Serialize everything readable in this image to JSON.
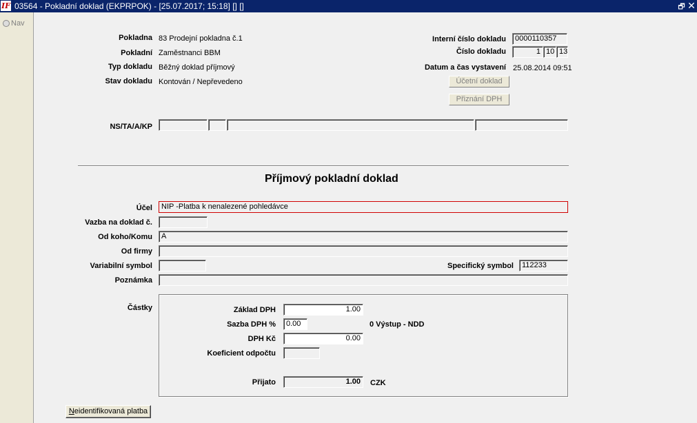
{
  "window": {
    "app_icon_text": "IF",
    "title": "03564 - Pokladní doklad (EKPRPOK) - [25.07.2017; 15:18] [] []",
    "restore_glyph": "🗗",
    "close_glyph": "✕"
  },
  "nav": {
    "label": "Nav"
  },
  "header": {
    "pokladna_label": "Pokladna",
    "pokladna_value": "83 Prodejní pokladna č.1",
    "pokladni_label": "Pokladní",
    "pokladni_value": "Zaměstnanci BBM",
    "typ_label": "Typ dokladu",
    "typ_value": "Běžný doklad příjmový",
    "stav_label": "Stav dokladu",
    "stav_value": "Kontován / Nepřevedeno",
    "interni_label": "Interní číslo dokladu",
    "interni_value": "0000110357",
    "cislo_label": "Číslo dokladu",
    "cislo_part1": "1",
    "cislo_part2": "10",
    "cislo_part3": "13",
    "datum_label": "Datum a čas vystavení",
    "datum_value": "25.08.2014 09:51",
    "ucetni_button": "Účetní doklad",
    "priznani_button": "Přiznání DPH",
    "ns_label": "NS/TA/A/KP",
    "ns_values": [
      "",
      "",
      "",
      ""
    ]
  },
  "form": {
    "heading": "Příjmový pokladní doklad",
    "ucel_label": "Účel",
    "ucel_value": "NIP -Platba k nenalezené pohledávce",
    "vazba_label": "Vazba na doklad č.",
    "vazba_value": "",
    "odkoho_label": "Od koho/Komu",
    "odkoho_value": "A",
    "odfirmy_label": "Od firmy",
    "odfirmy_value": "",
    "vs_label": "Variabilní symbol",
    "vs_value": "",
    "ss_label": "Specifický symbol",
    "ss_value": "112233",
    "poznamka_label": "Poznámka",
    "poznamka_value": ""
  },
  "castky": {
    "section_label": "Částky",
    "zaklad_label": "Základ DPH",
    "zaklad_value": "1.00",
    "sazba_label": "Sazba DPH %",
    "sazba_value": "0.00",
    "sazba_note": "0 Výstup  - NDD",
    "dph_label": "DPH Kč",
    "dph_value": "0.00",
    "koef_label": "Koeficient odpočtu",
    "koef_value": "",
    "prijato_label": "Přijato",
    "prijato_value": "1.00",
    "currency": "CZK"
  },
  "footer": {
    "neidentifikovana_first": "N",
    "neidentifikovana_rest": "eidentifikovaná platba"
  }
}
